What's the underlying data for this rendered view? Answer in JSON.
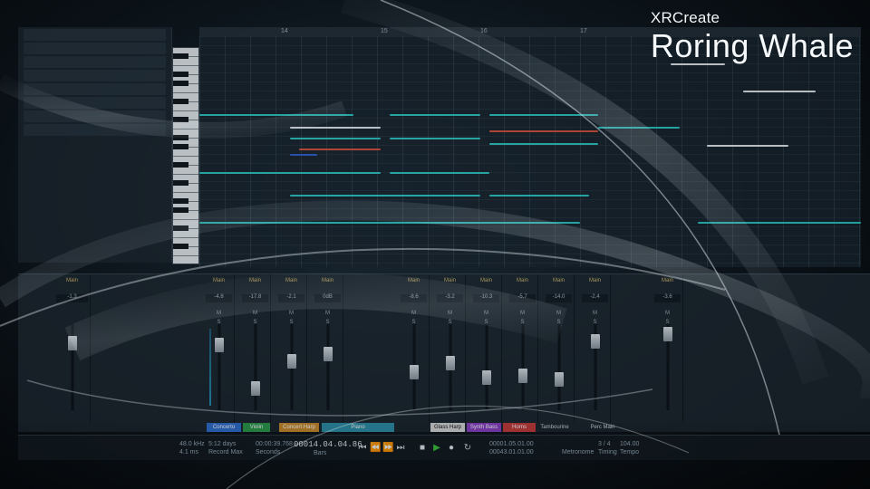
{
  "brand": {
    "subtitle": "XRCreate",
    "title": "Roring Whale"
  },
  "ruler": {
    "bars": [
      "14",
      "15",
      "16",
      "17"
    ]
  },
  "mixer": {
    "channels": [
      {
        "bus": "Main",
        "value": "-1.3"
      },
      {
        "bus": "Main",
        "value": "-4.8"
      },
      {
        "bus": "Main",
        "value": "-17.8"
      },
      {
        "bus": "Main",
        "value": "-2.1"
      },
      {
        "bus": "Main",
        "value": "0dB"
      },
      {
        "bus": "Main",
        "value": "-8.6"
      },
      {
        "bus": "Main",
        "value": "-3.2"
      },
      {
        "bus": "Main",
        "value": "-10.3"
      },
      {
        "bus": "Main",
        "value": "-5.7"
      },
      {
        "bus": "Main",
        "value": "-14.0"
      },
      {
        "bus": "Main",
        "value": "-2.4"
      },
      {
        "bus": "Main",
        "value": "-3.6"
      }
    ]
  },
  "tracks": [
    {
      "label": "Concerto",
      "color": "#2e6fd0"
    },
    {
      "label": "Violin",
      "color": "#2a9a4a"
    },
    {
      "label": "Concert Harp",
      "color": "#c98a2a"
    },
    {
      "label": "Piano",
      "color": "#2c8fa8"
    },
    {
      "label": "Glass Harp",
      "color": "#d9d9d9"
    },
    {
      "label": "Synth Bass",
      "color": "#8a3fc4"
    },
    {
      "label": "Horns",
      "color": "#c83a3a"
    },
    {
      "label": "Tambourine",
      "color": ""
    },
    {
      "label": "Perc Main",
      "color": ""
    }
  ],
  "transport": {
    "sample_rate": "48.0 kHz",
    "latency": "4.1 ms",
    "record_max": "5:12 days",
    "record_max_label": "Record Max",
    "seconds": "00:00:39.768",
    "seconds_label": "Seconds",
    "bars_position": "00014.04.04.86",
    "bars_label": "Bars",
    "loop_start": "00001.05.01.00",
    "loop_end": "00043.01.01.00",
    "time_sig": "3 / 4",
    "time_sig_label": "Timing",
    "tempo": "104.00",
    "tempo_label": "Tempo",
    "metronome_label": "Metronome"
  },
  "colors": {
    "note_cyan": "#2bc9c4",
    "note_red": "#d8503a",
    "note_white": "#e9eef2",
    "note_blue": "#2f5fd0",
    "fader_meter": "#2aa9d8"
  }
}
